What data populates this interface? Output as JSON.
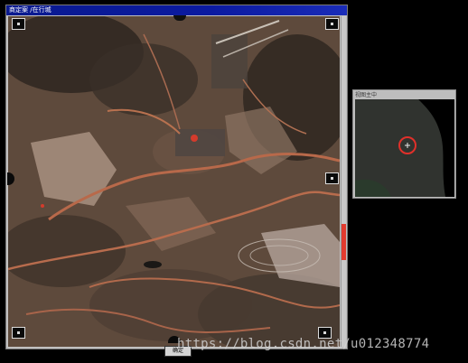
{
  "main_window": {
    "title": "商定案 /在行城"
  },
  "viewer": {
    "confirm_label": "确定"
  },
  "overview": {
    "title": "视图主中"
  },
  "watermark": {
    "text": "https://blog.csdn.net/u012348774"
  },
  "colors": {
    "titlebar": "#0b1aa0",
    "window_chrome": "#c0c0c0",
    "scroll_thumb": "#e23b2f",
    "overview_marker": "#e0302a",
    "terrain_base": "#5e4a3c",
    "road": "#b8694a"
  },
  "icons": {
    "nav_handle": "square-handle-icon",
    "location_marker": "crosshair-circle-icon"
  }
}
